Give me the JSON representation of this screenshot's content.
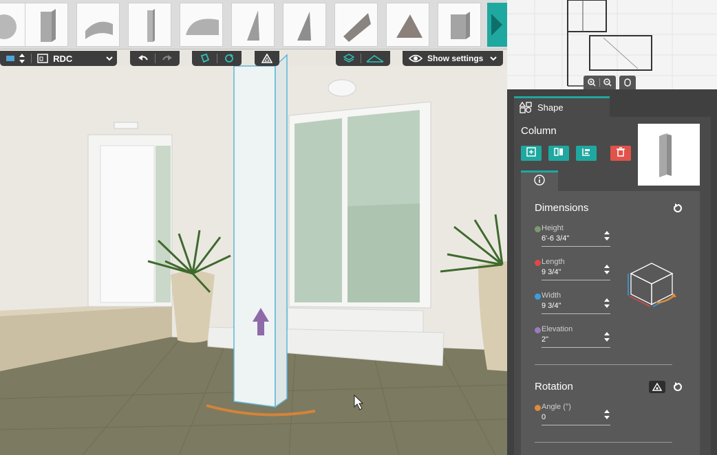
{
  "toolbar": {
    "level_label": "RDC",
    "show_settings_label": "Show settings"
  },
  "library": {
    "items": [
      "cylinder-partial",
      "box",
      "half-cylinder",
      "column",
      "quarter-cylinder",
      "cone-wedge",
      "wedge",
      "slope-wedge",
      "prism",
      "box-small"
    ]
  },
  "panel": {
    "tab_label": "Shape",
    "object_title": "Column",
    "dimensions": {
      "title": "Dimensions",
      "fields": [
        {
          "label": "Height",
          "value": "6'-6 3/4\"",
          "color": "#7c9a6c"
        },
        {
          "label": "Length",
          "value": "9 3/4\"",
          "color": "#e04848"
        },
        {
          "label": "Width",
          "value": "9 3/4\"",
          "color": "#3aa0e0"
        },
        {
          "label": "Elevation",
          "value": "2\"",
          "color": "#9a7abf"
        }
      ]
    },
    "rotation": {
      "title": "Rotation",
      "fields": [
        {
          "label": "Angle (°)",
          "value": "0",
          "color": "#e08a3a"
        }
      ]
    }
  },
  "colors": {
    "accent": "#1fa8a0",
    "delete": "#e0534a",
    "panel_bg": "#404040"
  }
}
